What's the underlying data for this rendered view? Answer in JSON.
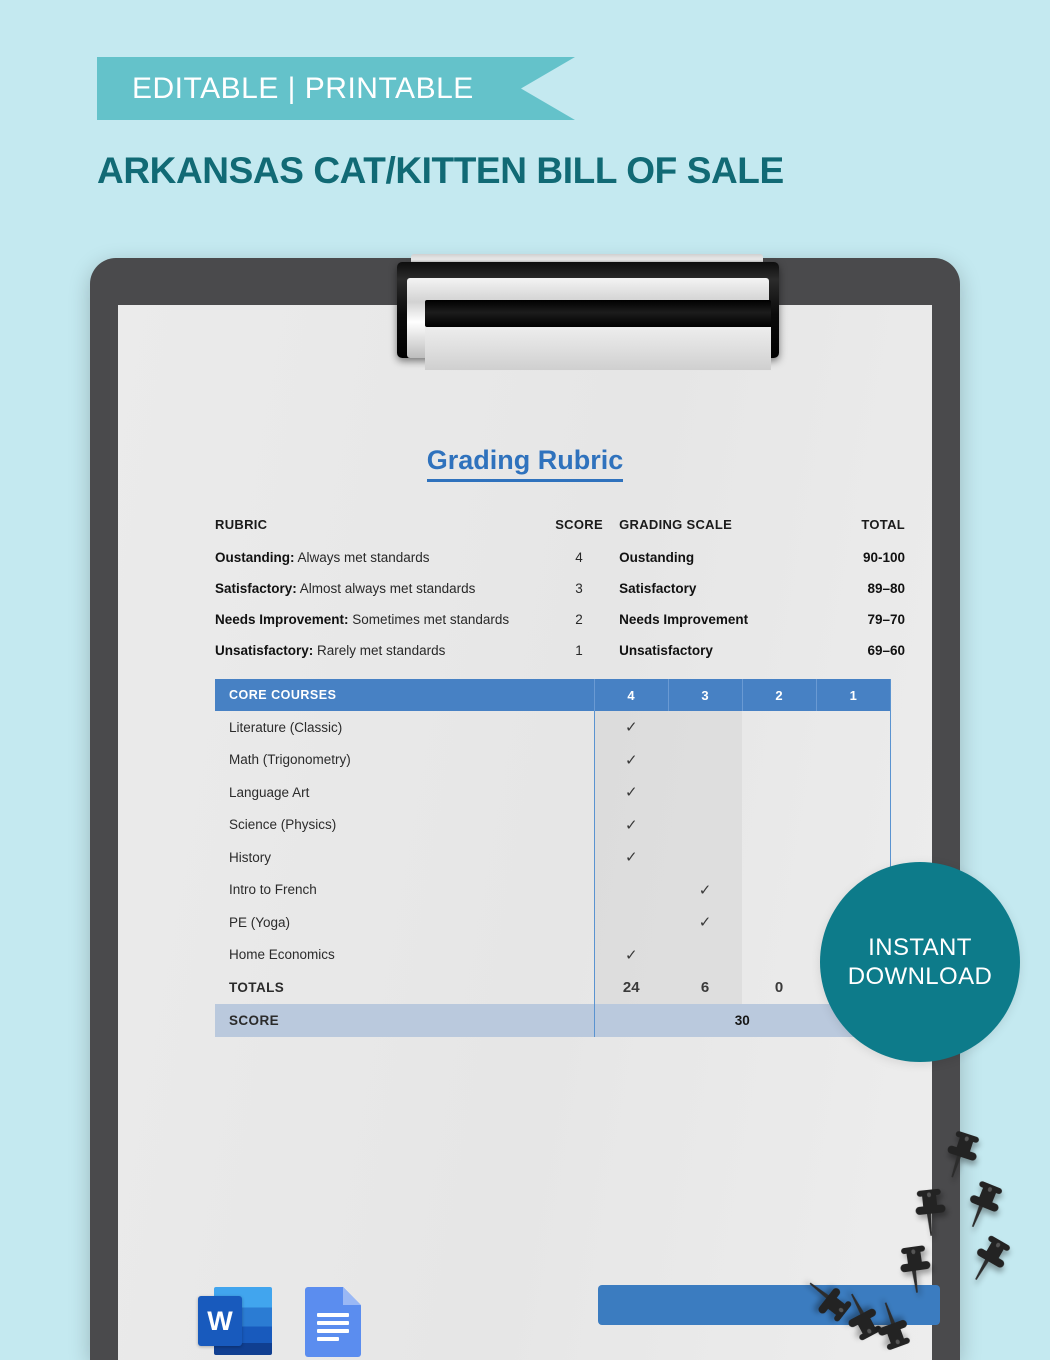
{
  "banner": {
    "label": "EDITABLE | PRINTABLE"
  },
  "page_title": "ARKANSAS CAT/KITTEN BILL OF SALE",
  "badge": {
    "line1": "INSTANT",
    "line2": "DOWNLOAD"
  },
  "document": {
    "title": "Grading Rubric",
    "legend": {
      "headers": {
        "rubric": "RUBRIC",
        "score": "SCORE",
        "grading_scale": "GRADING SCALE",
        "total": "TOTAL"
      },
      "rows": [
        {
          "term": "Oustanding:",
          "desc": " Always met standards",
          "score": "4",
          "scale": "Oustanding",
          "total": "90-100"
        },
        {
          "term": "Satisfactory:",
          "desc": " Almost always met standards",
          "score": "3",
          "scale": "Satisfactory",
          "total": "89–80"
        },
        {
          "term": "Needs Improvement:",
          "desc": " Sometimes met standards",
          "score": "2",
          "scale": "Needs Improvement",
          "total": "79–70"
        },
        {
          "term": "Unsatisfactory:",
          "desc": " Rarely met standards",
          "score": "1",
          "scale": "Unsatisfactory",
          "total": "69–60"
        }
      ]
    },
    "table": {
      "headers": [
        "CORE COURSES",
        "4",
        "3",
        "2",
        "1"
      ],
      "check_mark": "✓",
      "rows": [
        {
          "course": "Literature (Classic)",
          "c4": "✓",
          "c3": "",
          "c2": "",
          "c1": ""
        },
        {
          "course": "Math (Trigonometry)",
          "c4": "✓",
          "c3": "",
          "c2": "",
          "c1": ""
        },
        {
          "course": "Language Art",
          "c4": "✓",
          "c3": "",
          "c2": "",
          "c1": ""
        },
        {
          "course": "Science (Physics)",
          "c4": "✓",
          "c3": "",
          "c2": "",
          "c1": ""
        },
        {
          "course": "History",
          "c4": "✓",
          "c3": "",
          "c2": "",
          "c1": ""
        },
        {
          "course": "Intro to French",
          "c4": "",
          "c3": "✓",
          "c2": "",
          "c1": ""
        },
        {
          "course": "PE (Yoga)",
          "c4": "",
          "c3": "✓",
          "c2": "",
          "c1": ""
        },
        {
          "course": "Home Economics",
          "c4": "✓",
          "c3": "",
          "c2": "",
          "c1": ""
        }
      ],
      "totals": {
        "label": "TOTALS",
        "c4": "24",
        "c3": "6",
        "c2": "0",
        "c1": ""
      },
      "score": {
        "label": "SCORE",
        "value": "30"
      }
    }
  },
  "file_formats": [
    {
      "name": "Microsoft Word",
      "glyph": "W"
    },
    {
      "name": "Google Docs",
      "glyph": ""
    }
  ],
  "colors": {
    "background": "#c4e9f0",
    "banner": "#64c2ca",
    "title": "#116a75",
    "doc_title": "#2f72bd",
    "table_header": "#4781c4",
    "score_row": "#bac9dd",
    "badge": "#0d7b8a",
    "clipboard": "#4a4a4c",
    "paper": "#e9e9e9",
    "blue_bar": "#3b7cc0"
  }
}
